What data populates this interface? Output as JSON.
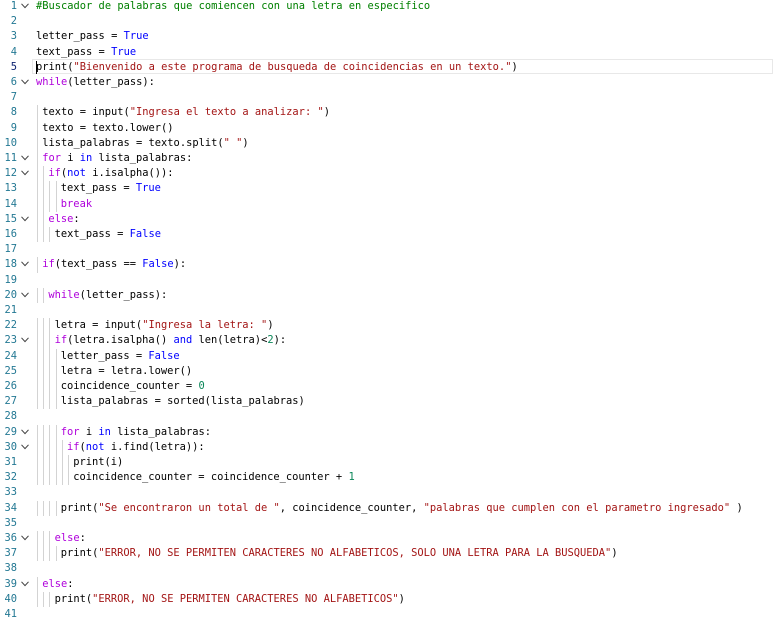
{
  "editor": {
    "active_line": 5,
    "lines": [
      {
        "n": "1",
        "fold": true,
        "indent": 0,
        "tokens": [
          [
            "cm",
            "#Buscador de palabras que comiencen con una letra en especifico"
          ]
        ]
      },
      {
        "n": "2",
        "fold": false,
        "indent": 0,
        "tokens": []
      },
      {
        "n": "3",
        "fold": false,
        "indent": 0,
        "tokens": [
          [
            "",
            "letter_pass = "
          ],
          [
            "kw",
            "True"
          ]
        ]
      },
      {
        "n": "4",
        "fold": false,
        "indent": 0,
        "tokens": [
          [
            "",
            "text_pass = "
          ],
          [
            "kw",
            "True"
          ]
        ]
      },
      {
        "n": "5",
        "fold": false,
        "indent": 0,
        "tokens": [
          [
            "",
            "print("
          ],
          [
            "str",
            "\"Bienvenido a este programa de busqueda de coincidencias en un texto.\""
          ],
          [
            "",
            ")"
          ]
        ]
      },
      {
        "n": "6",
        "fold": true,
        "indent": 0,
        "tokens": [
          [
            "ctl",
            "while"
          ],
          [
            "",
            "(letter_pass):"
          ]
        ]
      },
      {
        "n": "7",
        "fold": false,
        "indent": 0,
        "tokens": []
      },
      {
        "n": "8",
        "fold": false,
        "indent": 1,
        "tokens": [
          [
            "",
            "texto = input("
          ],
          [
            "str",
            "\"Ingresa el texto a analizar: \""
          ],
          [
            "",
            ")"
          ]
        ]
      },
      {
        "n": "9",
        "fold": false,
        "indent": 1,
        "tokens": [
          [
            "",
            "texto = texto.lower()"
          ]
        ]
      },
      {
        "n": "10",
        "fold": false,
        "indent": 1,
        "tokens": [
          [
            "",
            "lista_palabras = texto.split("
          ],
          [
            "str",
            "\" \""
          ],
          [
            "",
            ")"
          ]
        ]
      },
      {
        "n": "11",
        "fold": true,
        "indent": 1,
        "tokens": [
          [
            "ctl",
            "for"
          ],
          [
            "",
            " i "
          ],
          [
            "kw",
            "in"
          ],
          [
            "",
            " lista_palabras:"
          ]
        ]
      },
      {
        "n": "12",
        "fold": true,
        "indent": 2,
        "tokens": [
          [
            "ctl",
            "if"
          ],
          [
            "",
            "("
          ],
          [
            "kw",
            "not"
          ],
          [
            "",
            " i.isalpha()):"
          ]
        ]
      },
      {
        "n": "13",
        "fold": false,
        "indent": 4,
        "tokens": [
          [
            "",
            "text_pass = "
          ],
          [
            "kw",
            "True"
          ]
        ]
      },
      {
        "n": "14",
        "fold": false,
        "indent": 4,
        "tokens": [
          [
            "ctl",
            "break"
          ]
        ]
      },
      {
        "n": "15",
        "fold": true,
        "indent": 2,
        "tokens": [
          [
            "ctl",
            "else"
          ],
          [
            "",
            ":"
          ]
        ]
      },
      {
        "n": "16",
        "fold": false,
        "indent": 3,
        "tokens": [
          [
            "",
            "text_pass = "
          ],
          [
            "kw",
            "False"
          ]
        ]
      },
      {
        "n": "17",
        "fold": false,
        "indent": 0,
        "tokens": []
      },
      {
        "n": "18",
        "fold": true,
        "indent": 1,
        "tokens": [
          [
            "ctl",
            "if"
          ],
          [
            "",
            "(text_pass == "
          ],
          [
            "kw",
            "False"
          ],
          [
            "",
            "):"
          ]
        ]
      },
      {
        "n": "19",
        "fold": false,
        "indent": 0,
        "tokens": []
      },
      {
        "n": "20",
        "fold": true,
        "indent": 2,
        "tokens": [
          [
            "ctl",
            "while"
          ],
          [
            "",
            "(letter_pass):"
          ]
        ]
      },
      {
        "n": "21",
        "fold": false,
        "indent": 0,
        "tokens": []
      },
      {
        "n": "22",
        "fold": false,
        "indent": 3,
        "tokens": [
          [
            "",
            "letra = input("
          ],
          [
            "str",
            "\"Ingresa la letra: \""
          ],
          [
            "",
            ")"
          ]
        ]
      },
      {
        "n": "23",
        "fold": true,
        "indent": 3,
        "tokens": [
          [
            "ctl",
            "if"
          ],
          [
            "",
            "(letra.isalpha() "
          ],
          [
            "kw",
            "and"
          ],
          [
            "",
            " len(letra)<"
          ],
          [
            "num",
            "2"
          ],
          [
            "",
            "):"
          ]
        ]
      },
      {
        "n": "24",
        "fold": false,
        "indent": 4,
        "tokens": [
          [
            "",
            "letter_pass = "
          ],
          [
            "kw",
            "False"
          ]
        ]
      },
      {
        "n": "25",
        "fold": false,
        "indent": 4,
        "tokens": [
          [
            "",
            "letra = letra.lower()"
          ]
        ]
      },
      {
        "n": "26",
        "fold": false,
        "indent": 4,
        "tokens": [
          [
            "",
            "coincidence_counter = "
          ],
          [
            "num",
            "0"
          ]
        ]
      },
      {
        "n": "27",
        "fold": false,
        "indent": 4,
        "tokens": [
          [
            "",
            "lista_palabras = sorted(lista_palabras)"
          ]
        ]
      },
      {
        "n": "28",
        "fold": false,
        "indent": 0,
        "tokens": []
      },
      {
        "n": "29",
        "fold": true,
        "indent": 4,
        "tokens": [
          [
            "ctl",
            "for"
          ],
          [
            "",
            " i "
          ],
          [
            "kw",
            "in"
          ],
          [
            "",
            " lista_palabras:"
          ]
        ]
      },
      {
        "n": "30",
        "fold": true,
        "indent": 5,
        "tokens": [
          [
            "ctl",
            "if"
          ],
          [
            "",
            "("
          ],
          [
            "kw",
            "not"
          ],
          [
            "",
            " i.find(letra)):"
          ]
        ]
      },
      {
        "n": "31",
        "fold": false,
        "indent": 6,
        "tokens": [
          [
            "",
            "print(i)"
          ]
        ]
      },
      {
        "n": "32",
        "fold": false,
        "indent": 6,
        "tokens": [
          [
            "",
            "coincidence_counter = coincidence_counter + "
          ],
          [
            "num",
            "1"
          ]
        ]
      },
      {
        "n": "33",
        "fold": false,
        "indent": 0,
        "tokens": []
      },
      {
        "n": "34",
        "fold": false,
        "indent": 4,
        "tokens": [
          [
            "",
            "print("
          ],
          [
            "str",
            "\"Se encontraron un total de \""
          ],
          [
            "",
            ", coincidence_counter, "
          ],
          [
            "str",
            "\"palabras que cumplen con el parametro ingresado\""
          ],
          [
            "",
            " )"
          ]
        ]
      },
      {
        "n": "35",
        "fold": false,
        "indent": 0,
        "tokens": []
      },
      {
        "n": "36",
        "fold": true,
        "indent": 3,
        "tokens": [
          [
            "ctl",
            "else"
          ],
          [
            "",
            ":"
          ]
        ]
      },
      {
        "n": "37",
        "fold": false,
        "indent": 4,
        "tokens": [
          [
            "",
            "print("
          ],
          [
            "str",
            "\"ERROR, NO SE PERMITEN CARACTERES NO ALFABETICOS, SOLO UNA LETRA PARA LA BUSQUEDA\""
          ],
          [
            "",
            ")"
          ]
        ]
      },
      {
        "n": "38",
        "fold": false,
        "indent": 0,
        "tokens": []
      },
      {
        "n": "39",
        "fold": true,
        "indent": 1,
        "tokens": [
          [
            "ctl",
            "else"
          ],
          [
            "",
            ":"
          ]
        ]
      },
      {
        "n": "40",
        "fold": false,
        "indent": 3,
        "tokens": [
          [
            "",
            "print("
          ],
          [
            "str",
            "\"ERROR, NO SE PERMITEN CARACTERES NO ALFABETICOS\""
          ],
          [
            "",
            ")"
          ]
        ]
      },
      {
        "n": "41",
        "fold": false,
        "indent": 0,
        "tokens": []
      }
    ]
  },
  "colors": {
    "comment": "#008000",
    "keyword": "#0000ff",
    "control": "#af00db",
    "string": "#a31515",
    "number": "#098658",
    "line_number": "#237893"
  },
  "icons": {
    "fold": "chevron-down-icon"
  }
}
